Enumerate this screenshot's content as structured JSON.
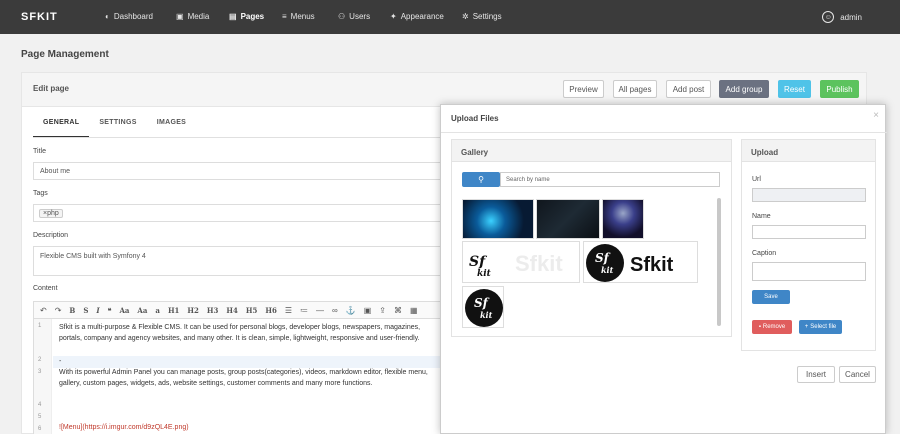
{
  "nav": {
    "brand": "SFKIT",
    "items": [
      {
        "label": "Dashboard",
        "icon": "palette-icon"
      },
      {
        "label": "Media",
        "icon": "image-icon"
      },
      {
        "label": "Pages",
        "icon": "file-icon"
      },
      {
        "label": "Menus",
        "icon": "menu-icon"
      },
      {
        "label": "Users",
        "icon": "users-icon"
      },
      {
        "label": "Appearance",
        "icon": "puzzle-icon"
      },
      {
        "label": "Settings",
        "icon": "gear-icon"
      }
    ],
    "active": "Pages",
    "user": "admin"
  },
  "page": {
    "title": "Page Management",
    "panel_title": "Edit page",
    "buttons": {
      "preview": "Preview",
      "all_pages": "All pages",
      "add_post": "Add post",
      "add_group": "Add group",
      "reset": "Reset",
      "publish": "Publish"
    },
    "tabs": [
      "GENERAL",
      "SETTINGS",
      "IMAGES"
    ],
    "active_tab": "GENERAL"
  },
  "form": {
    "title_label": "Title",
    "title_value": "About me",
    "tags_label": "Tags",
    "tags": [
      "php"
    ],
    "tag_remove": "×",
    "description_label": "Description",
    "description_value": "Flexible CMS built with Symfony 4",
    "content_label": "Content",
    "toolbar_headings": [
      "H1",
      "H2",
      "H3",
      "H4",
      "H5",
      "H6"
    ],
    "toolbar_text": [
      "B",
      "S",
      "I",
      "❝",
      "Aa",
      "Aa",
      "a"
    ],
    "editor_lines": [
      {
        "n": "1",
        "text": "Sfkit is a multi-purpose & Flexible CMS. It can be used for personal blogs, developer blogs, newspapers, magazines, portals, company and agency websites, and many other. It is clean, simple, lightweight, responsive and user-friendly."
      },
      {
        "n": "2",
        "text": "-"
      },
      {
        "n": "3",
        "text": "With its powerful Admin Panel you can manage posts, group posts(categories), videos, markdown editor, flexible menu, gallery, custom pages, widgets, ads, website settings, customer comments and many more functions."
      },
      {
        "n": "4",
        "text": ""
      },
      {
        "n": "5",
        "text": ""
      },
      {
        "n": "6",
        "text": "![Menu](https://i.imgur.com/d9zQL4E.png)"
      },
      {
        "n": "7",
        "text": ""
      }
    ]
  },
  "modal": {
    "title": "Upload Files",
    "close": "×",
    "gallery_title": "Gallery",
    "search_placeholder": "Search by name",
    "upload_title": "Upload",
    "url_label": "Url",
    "name_label": "Name",
    "caption_label": "Caption",
    "save": "Save",
    "remove": "Remove",
    "select_file": "Select file",
    "insert": "Insert",
    "cancel": "Cancel",
    "logo_text": "Sfkit",
    "logo_mark": "Sf kit"
  },
  "colors": {
    "nav_bg": "#3b3b3b",
    "add_group": "#6b7181",
    "reset": "#4fc3e8",
    "publish": "#5cc35e",
    "primary": "#3f86c7",
    "danger": "#e05d5d"
  }
}
